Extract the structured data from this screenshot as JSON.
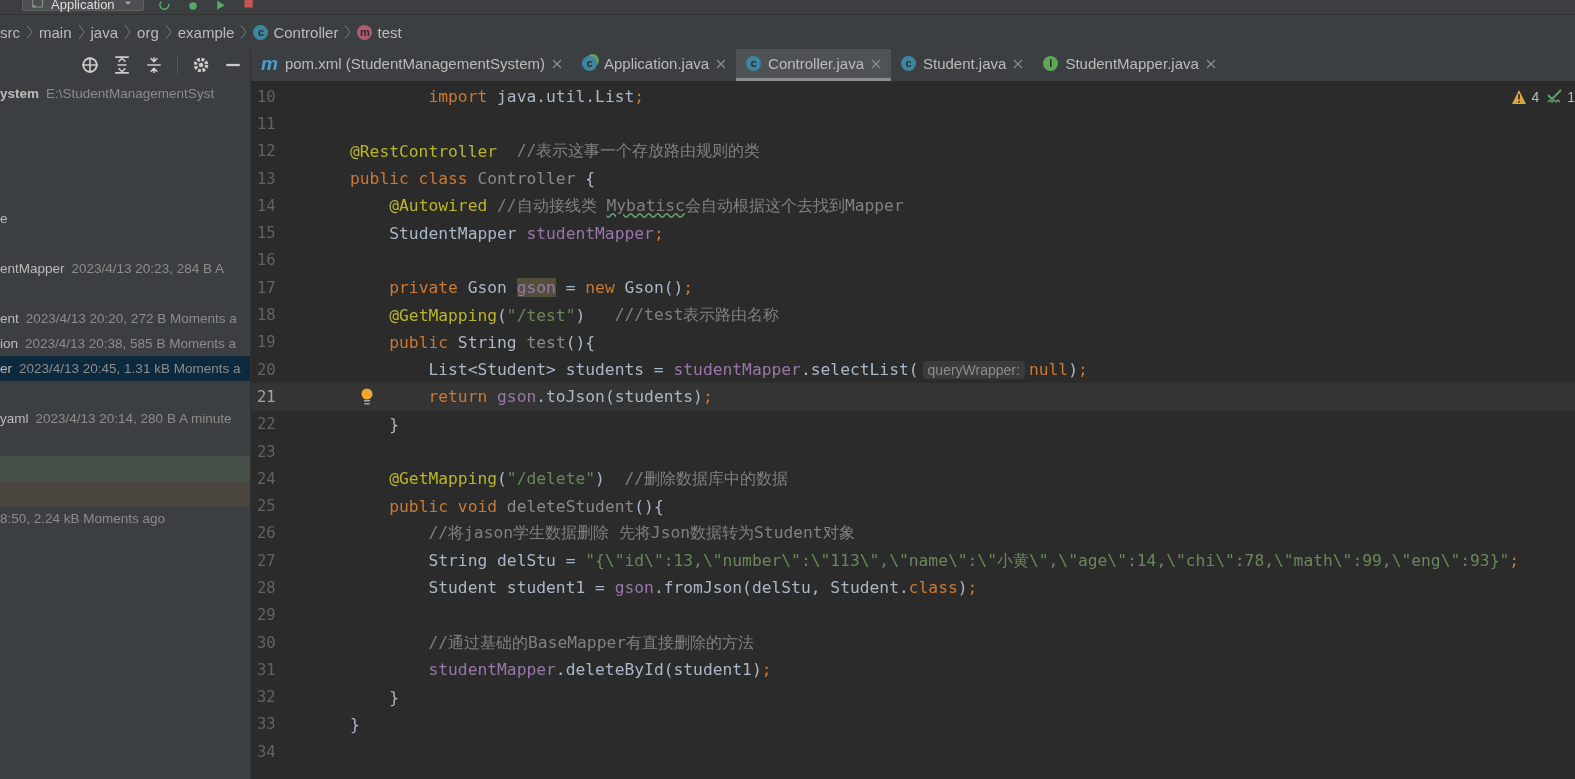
{
  "toolbar": {
    "run_config": "Application"
  },
  "breadcrumbs": [
    {
      "label": "src",
      "kind": "folder"
    },
    {
      "label": "main",
      "kind": "folder"
    },
    {
      "label": "java",
      "kind": "folder"
    },
    {
      "label": "org",
      "kind": "folder"
    },
    {
      "label": "example",
      "kind": "folder"
    },
    {
      "label": "Controller",
      "kind": "class",
      "icon_letter": "c"
    },
    {
      "label": "test",
      "kind": "method",
      "icon_letter": "m"
    }
  ],
  "project_tree": {
    "rows": [
      {
        "kind": "item",
        "name": "ystem",
        "meta": "E:\\StudentManagementSyst",
        "selected": false
      },
      {
        "kind": "blank"
      },
      {
        "kind": "blank"
      },
      {
        "kind": "blank"
      },
      {
        "kind": "blank"
      },
      {
        "kind": "item",
        "name": "e",
        "selected": false
      },
      {
        "kind": "blank"
      },
      {
        "kind": "item",
        "name": "entMapper",
        "meta": "2023/4/13 20:23, 284 B A",
        "selected": false
      },
      {
        "kind": "blank"
      },
      {
        "kind": "item",
        "name": "ent",
        "meta": "2023/4/13 20:20, 272 B Moments a",
        "selected": false
      },
      {
        "kind": "item",
        "name": "ion",
        "meta": "2023/4/13 20:38, 585 B Moments a",
        "selected": false
      },
      {
        "kind": "item",
        "name": "er",
        "meta": "2023/4/13 20:45, 1.31 kB Moments a",
        "selected": true
      },
      {
        "kind": "blank"
      },
      {
        "kind": "item",
        "name": "yaml",
        "meta": "2023/4/13 20:14, 280 B A minute",
        "selected": false
      },
      {
        "kind": "blank"
      },
      {
        "kind": "band",
        "color": "#475048"
      },
      {
        "kind": "band",
        "color": "#4b463d"
      },
      {
        "kind": "item",
        "meta": "8:50, 2.24 kB Moments ago",
        "selected": false
      }
    ]
  },
  "tabs": [
    {
      "label": "pom.xml (StudentManagementSystem)",
      "kind": "maven",
      "icon_letter": "m",
      "selected": false
    },
    {
      "label": "Application.java",
      "kind": "runnable",
      "icon_letter": "c",
      "selected": false
    },
    {
      "label": "Controller.java",
      "kind": "class",
      "icon_letter": "c",
      "selected": true
    },
    {
      "label": "Student.java",
      "kind": "class",
      "icon_letter": "c",
      "selected": false
    },
    {
      "label": "StudentMapper.java",
      "kind": "interface",
      "icon_letter": "I",
      "selected": false
    }
  ],
  "editor": {
    "warnings": "4",
    "checks": "1",
    "lines": [
      {
        "number": "10",
        "current": false,
        "tokens": [
          {
            "kind": "keyword",
            "text": "        import"
          },
          {
            "kind": "plain",
            "text": " java.util.List"
          },
          {
            "kind": "keyword",
            "text": ";"
          }
        ]
      },
      {
        "number": "11",
        "current": false
      },
      {
        "number": "12",
        "current": false,
        "tokens": [
          {
            "kind": "annotation",
            "text": "@RestController"
          },
          {
            "kind": "comment",
            "text": "  //表示这事一个存放路由规则的类"
          }
        ]
      },
      {
        "number": "13",
        "current": false,
        "tokens": [
          {
            "kind": "keyword",
            "text": "public class "
          },
          {
            "kind": "unused",
            "text": "Controller"
          },
          {
            "kind": "plain",
            "text": " {"
          }
        ]
      },
      {
        "number": "14",
        "current": false,
        "tokens": [
          {
            "kind": "annotation",
            "text": "    @Autowired"
          },
          {
            "kind": "comment",
            "text": " //自动接线类 "
          },
          {
            "kind": "typo",
            "text": "Mybatisc"
          },
          {
            "kind": "comment",
            "text": "会自动根据这个去找到Mapper"
          }
        ]
      },
      {
        "number": "15",
        "current": false,
        "tokens": [
          {
            "kind": "plain",
            "text": "    StudentMapper "
          },
          {
            "kind": "field",
            "text": "studentMapper"
          },
          {
            "kind": "keyword",
            "text": ";"
          }
        ]
      },
      {
        "number": "16",
        "current": false
      },
      {
        "number": "17",
        "current": false,
        "tokens": [
          {
            "kind": "keyword",
            "text": "    private "
          },
          {
            "kind": "plain",
            "text": "Gson "
          },
          {
            "kind": "occurrence",
            "text": "gson"
          },
          {
            "kind": "plain",
            "text": " = "
          },
          {
            "kind": "keyword",
            "text": "new "
          },
          {
            "kind": "plain",
            "text": "Gson()"
          },
          {
            "kind": "keyword",
            "text": ";"
          }
        ]
      },
      {
        "number": "18",
        "current": false,
        "tokens": [
          {
            "kind": "annotation",
            "text": "    @GetMapping"
          },
          {
            "kind": "plain",
            "text": "("
          },
          {
            "kind": "string",
            "text": "\"/test\""
          },
          {
            "kind": "plain",
            "text": ")"
          },
          {
            "kind": "comment",
            "text": "   ///test表示路由名称"
          }
        ]
      },
      {
        "number": "19",
        "current": false,
        "tokens": [
          {
            "kind": "keyword",
            "text": "    public "
          },
          {
            "kind": "plain",
            "text": "String "
          },
          {
            "kind": "unused",
            "text": "test"
          },
          {
            "kind": "plain",
            "text": "(){"
          }
        ]
      },
      {
        "number": "20",
        "current": false,
        "tokens": [
          {
            "kind": "plain",
            "text": "        List<Student> students = "
          },
          {
            "kind": "field",
            "text": "studentMapper"
          },
          {
            "kind": "plain",
            "text": ".selectList("
          },
          {
            "kind": "hint",
            "text": "queryWrapper:"
          },
          {
            "kind": "keyword",
            "text": "null"
          },
          {
            "kind": "plain",
            "text": ")"
          },
          {
            "kind": "keyword",
            "text": ";"
          }
        ]
      },
      {
        "number": "21",
        "current": true,
        "bulb": true,
        "tokens": [
          {
            "kind": "keyword",
            "text": "        return "
          },
          {
            "kind": "field",
            "text": "gson"
          },
          {
            "kind": "plain",
            "text": ".toJson(students)"
          },
          {
            "kind": "keyword",
            "text": ";"
          }
        ]
      },
      {
        "number": "22",
        "current": false,
        "tokens": [
          {
            "kind": "plain",
            "text": "    }"
          }
        ]
      },
      {
        "number": "23",
        "current": false
      },
      {
        "number": "24",
        "current": false,
        "tokens": [
          {
            "kind": "annotation",
            "text": "    @GetMapping"
          },
          {
            "kind": "plain",
            "text": "("
          },
          {
            "kind": "string",
            "text": "\"/delete\""
          },
          {
            "kind": "plain",
            "text": ")"
          },
          {
            "kind": "comment",
            "text": "  //删除数据库中的数据"
          }
        ]
      },
      {
        "number": "25",
        "current": false,
        "tokens": [
          {
            "kind": "keyword",
            "text": "    public void "
          },
          {
            "kind": "unused",
            "text": "deleteStudent"
          },
          {
            "kind": "plain",
            "text": "(){"
          }
        ]
      },
      {
        "number": "26",
        "current": false,
        "tokens": [
          {
            "kind": "comment",
            "text": "        //将jason学生数据删除 先将Json数据转为Student对象"
          }
        ]
      },
      {
        "number": "27",
        "current": false,
        "tokens": [
          {
            "kind": "plain",
            "text": "        String delStu = "
          },
          {
            "kind": "string",
            "text": "\"{\\\"id\\\":13,\\\"number\\\":\\\"113\\\",\\\"name\\\":\\\"小黄\\\",\\\"age\\\":14,\\\"chi\\\":78,\\\"math\\\":99,\\\"eng\\\":93}\""
          },
          {
            "kind": "keyword",
            "text": ";"
          }
        ]
      },
      {
        "number": "28",
        "current": false,
        "tokens": [
          {
            "kind": "plain",
            "text": "        Student student1 = "
          },
          {
            "kind": "field",
            "text": "gson"
          },
          {
            "kind": "plain",
            "text": ".fromJson(delStu, Student."
          },
          {
            "kind": "keyword",
            "text": "class"
          },
          {
            "kind": "plain",
            "text": ")"
          },
          {
            "kind": "keyword",
            "text": ";"
          }
        ]
      },
      {
        "number": "29",
        "current": false
      },
      {
        "number": "30",
        "current": false,
        "tokens": [
          {
            "kind": "comment",
            "text": "        //通过基础的BaseMapper有直接删除的方法"
          }
        ]
      },
      {
        "number": "31",
        "current": false,
        "tokens": [
          {
            "kind": "field",
            "text": "        studentMapper"
          },
          {
            "kind": "plain",
            "text": ".deleteById(student1)"
          },
          {
            "kind": "keyword",
            "text": ";"
          }
        ]
      },
      {
        "number": "32",
        "current": false,
        "tokens": [
          {
            "kind": "plain",
            "text": "    }"
          }
        ]
      },
      {
        "number": "33",
        "current": false,
        "tokens": [
          {
            "kind": "plain",
            "text": "}"
          }
        ]
      },
      {
        "number": "34",
        "current": false
      }
    ]
  }
}
